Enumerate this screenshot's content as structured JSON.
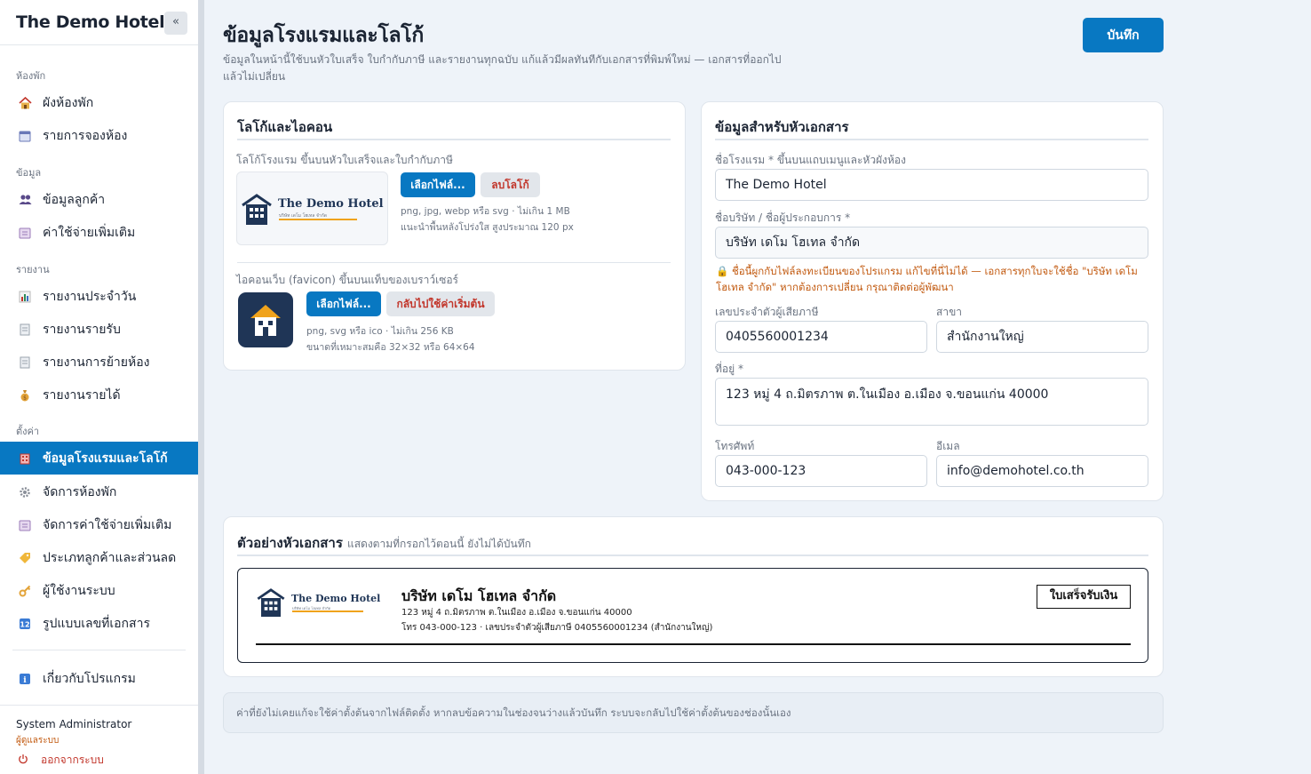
{
  "sidebar": {
    "brand": "The Demo Hotel",
    "collapse_label": "«",
    "sections": {
      "rooms": "ห้องพัก",
      "data": "ข้อมูล",
      "reports": "รายงาน",
      "settings": "ตั้งค่า"
    },
    "items": {
      "room_map": "ผังห้องพัก",
      "bookings": "รายการจองห้อง",
      "customers": "ข้อมูลลูกค้า",
      "extra_charges": "ค่าใช้จ่ายเพิ่มเติม",
      "daily_report": "รายงานประจำวัน",
      "receipts_report": "รายงานรายรับ",
      "room_move_report": "รายงานการย้ายห้อง",
      "income_report": "รายงานรายได้",
      "hotel_info": "ข้อมูลโรงแรมและโลโก้",
      "manage_rooms": "จัดการห้องพัก",
      "manage_charges": "จัดการค่าใช้จ่ายเพิ่มเติม",
      "customer_types": "ประเภทลูกค้าและส่วนลด",
      "users": "ผู้ใช้งานระบบ",
      "doc_numbers": "รูปแบบเลขที่เอกสาร",
      "about": "เกี่ยวกับโปรแกรม"
    },
    "user": {
      "name": "System Administrator",
      "role": "ผู้ดูแลระบบ",
      "logout": "ออกจากระบบ"
    }
  },
  "page": {
    "title": "ข้อมูลโรงแรมและโลโก้",
    "subtitle": "ข้อมูลในหน้านี้ใช้บนหัวใบเสร็จ ใบกำกับภาษี และรายงานทุกฉบับ แก้แล้วมีผลทันทีกับเอกสารที่พิมพ์ใหม่ — เอกสารที่ออกไปแล้วไม่เปลี่ยน",
    "save_label": "บันทึก"
  },
  "logo_card": {
    "title": "โลโก้และไอคอน",
    "logo_label": "โลโก้โรงแรม",
    "logo_hint": "ขึ้นบนหัวใบเสร็จและใบกำกับภาษี",
    "logo_name": "The Demo Hotel",
    "logo_tagline": "บริษัท เดโม โฮเทล จำกัด",
    "choose_file": "เลือกไฟล์...",
    "remove_logo": "ลบโลโก้",
    "logo_note1": "png, jpg, webp หรือ svg · ไม่เกิน 1 MB",
    "logo_note2": "แนะนำพื้นหลังโปร่งใส สูงประมาณ 120 px",
    "favicon_label": "ไอคอนเว็บ (favicon)",
    "favicon_hint": "ขึ้นบนแท็บของเบราว์เซอร์",
    "choose_file2": "เลือกไฟล์...",
    "reset_default": "กลับไปใช้ค่าเริ่มต้น",
    "favicon_note1": "png, svg หรือ ico · ไม่เกิน 256 KB",
    "favicon_note2": "ขนาดที่เหมาะสมคือ 32×32 หรือ 64×64"
  },
  "header_card": {
    "title": "ข้อมูลสำหรับหัวเอกสาร",
    "hotel_name_label": "ชื่อโรงแรม *",
    "hotel_name_hint": "ขึ้นบนแถบเมนูและหัวผังห้อง",
    "hotel_name_value": "The Demo Hotel",
    "company_label": "ชื่อบริษัท / ชื่อผู้ประกอบการ *",
    "company_value": "บริษัท เดโม โฮเทล จำกัด",
    "warning": "🔒 ชื่อนี้ผูกกับไฟล์ลงทะเบียนของโปรแกรม แก้ไขที่นี่ไม่ได้ — เอกสารทุกใบจะใช้ชื่อ \"บริษัท เดโม โฮเทล จำกัด\" หากต้องการเปลี่ยน กรุณาติดต่อผู้พัฒนา",
    "tax_id_label": "เลขประจำตัวผู้เสียภาษี",
    "tax_id_value": "0405560001234",
    "branch_label": "สาขา",
    "branch_value": "สำนักงานใหญ่",
    "address_label": "ที่อยู่ *",
    "address_value": "123 หมู่ 4 ถ.มิตรภาพ ต.ในเมือง อ.เมือง จ.ขอนแก่น 40000",
    "phone_label": "โทรศัพท์",
    "phone_value": "043-000-123",
    "email_label": "อีเมล",
    "email_value": "info@demohotel.co.th"
  },
  "preview_card": {
    "title": "ตัวอย่างหัวเอกสาร",
    "hint": "แสดงตามที่กรอกไว้ตอนนี้ ยังไม่ได้บันทึก",
    "logo_name": "The Demo Hotel",
    "logo_tagline": "บริษัท เดโม โฮเทล จำกัด",
    "company": "บริษัท เดโม โฮเทล จำกัด",
    "address": "123 หมู่ 4 ถ.มิตรภาพ ต.ในเมือง อ.เมือง จ.ขอนแก่น 40000",
    "contact": "โทร 043-000-123 · เลขประจำตัวผู้เสียภาษี 0405560001234 (สำนักงานใหญ่)",
    "doc_type": "ใบเสร็จรับเงิน"
  },
  "footnote": "ค่าที่ยังไม่เคยแก้จะใช้ค่าตั้งต้นจากไฟล์ติดตั้ง หากลบข้อความในช่องจนว่างแล้วบันทึก ระบบจะกลับไปใช้ค่าตั้งต้นของช่องนั้นเอง",
  "colors": {
    "primary": "#0878c2",
    "danger": "#c2362b",
    "warning": "#c25a10",
    "navy": "#1f3556",
    "gold": "#f0a31c"
  }
}
